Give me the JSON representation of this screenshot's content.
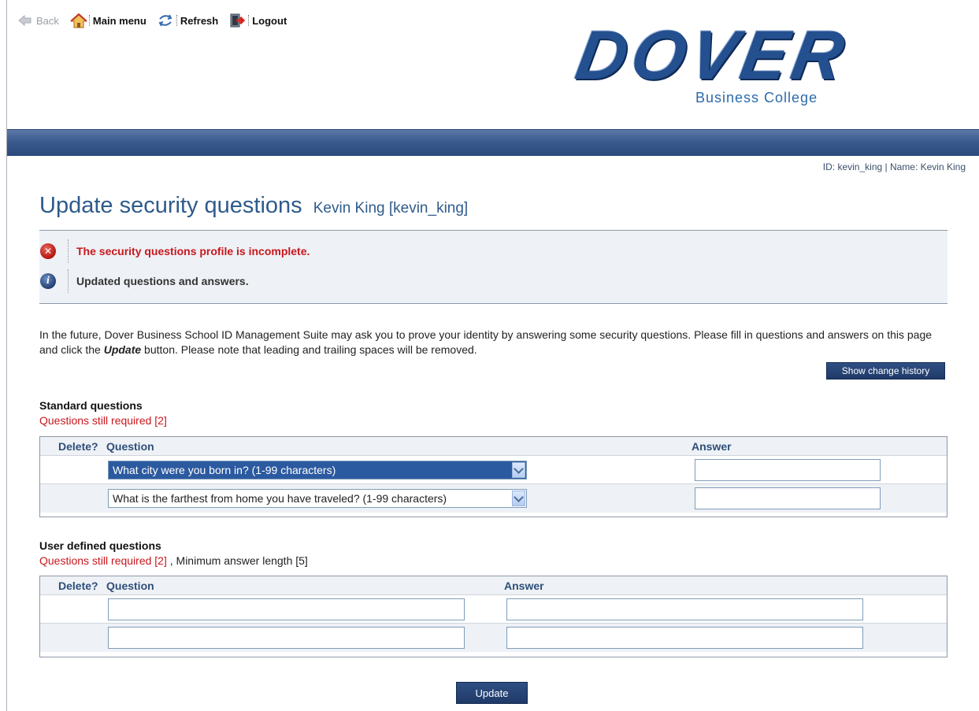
{
  "toolbar": {
    "back_label": "Back",
    "main_menu_label": "Main menu",
    "refresh_label": "Refresh",
    "logout_label": "Logout"
  },
  "logo": {
    "word": "DOVER",
    "subtitle": "Business College"
  },
  "user_info": "ID: kevin_king  |  Name: Kevin King",
  "page": {
    "title": "Update security questions",
    "subtitle": "Kevin King [kevin_king]"
  },
  "messages": {
    "error": "The security questions profile is incomplete.",
    "info": "Updated questions and answers."
  },
  "intro": {
    "part1": "In the future, Dover Business School ID Management Suite may ask you to prove your identity by answering some security questions. Please fill in questions and answers on this page and click the ",
    "emphasis": "Update",
    "part2": " button. Please note that leading and trailing spaces will be removed."
  },
  "buttons": {
    "show_history": "Show change history",
    "update": "Update"
  },
  "standard": {
    "title": "Standard questions",
    "required": "Questions still required [2]",
    "headers": {
      "delete": "Delete?",
      "question": "Question",
      "answer": "Answer"
    },
    "rows": [
      {
        "question": "What city were you born in? (1-99 characters)",
        "answer": ""
      },
      {
        "question": "What is the farthest from home you have traveled? (1-99 characters)",
        "answer": ""
      }
    ]
  },
  "user_defined": {
    "title": "User defined questions",
    "required": "Questions still required [2]",
    "min_length": " , Minimum answer length [5]",
    "headers": {
      "delete": "Delete?",
      "question": "Question",
      "answer": "Answer"
    },
    "rows": [
      {
        "question": "",
        "answer": ""
      },
      {
        "question": "",
        "answer": ""
      }
    ]
  },
  "colors": {
    "accent": "#2e5b8c",
    "error": "#c8171d",
    "band": "#3a5a8f"
  },
  "icons": [
    "back-arrow-icon",
    "home-icon",
    "refresh-icon",
    "logout-icon",
    "error-icon",
    "info-icon",
    "chevron-down-icon"
  ]
}
